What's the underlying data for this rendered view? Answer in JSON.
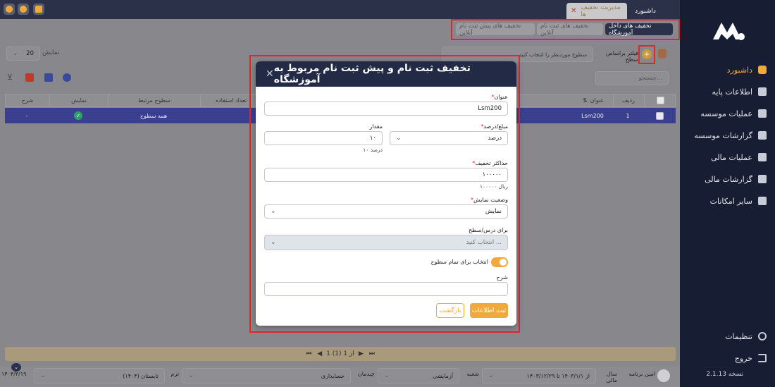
{
  "topbar": {
    "tabs": [
      {
        "label": "داشبورد"
      },
      {
        "label": "مدیریت تخفیف ها"
      }
    ],
    "close_symbol": "✕"
  },
  "sidebar": {
    "items": [
      {
        "label": "داشبورد",
        "icon": "dashboard-icon",
        "active": true
      },
      {
        "label": "اطلاعات پایه",
        "icon": "layers-icon"
      },
      {
        "label": "عملیات موسسه",
        "icon": "database-icon"
      },
      {
        "label": "گزارشات موسسه",
        "icon": "bar-chart-icon"
      },
      {
        "label": "عملیات مالی",
        "icon": "finance-icon"
      },
      {
        "label": "گزارشات مالی",
        "icon": "report-icon"
      },
      {
        "label": "سایر امکانات",
        "icon": "more-icon"
      }
    ],
    "settings_label": "تنظیمات",
    "logout_label": "خروج",
    "version": "نسخه 2.1.13"
  },
  "subtabs": [
    {
      "label": "تخفیف های داخل آموزشگاه",
      "active": true
    },
    {
      "label": "تخفیف های ثبت نام آنلاین"
    },
    {
      "label": "تخفیف های پیش ثبت نام آنلاین"
    }
  ],
  "toolbar": {
    "filter_label": "فیلتر براساس سطح",
    "filter_placeholder": "سطوح موردنظر را انتخاب کنید",
    "show_label": "نمایش",
    "page_size": "20",
    "search_placeholder": "جستجو..."
  },
  "grid": {
    "headers": [
      "ردیف",
      "عنوان",
      "تعداد استفاده",
      "سطوح مرتبط",
      "نمایش",
      "شرح"
    ],
    "row": {
      "index": "1",
      "title": "Lsm200",
      "levels": "همه سطوح",
      "desc": "-"
    }
  },
  "pager": {
    "text": "1 از 1 (1)"
  },
  "bottombar": {
    "user": "امین برنامه",
    "fiscal_year_label": "سال مالی",
    "fiscal_year": "از ۱۴۰۳/۱/۱ تا ۱۴۰۳/۱۲/۲۹",
    "branch_label": "شعبه",
    "branch": "آزمایشی",
    "section_label": "چیدمان",
    "section": "حسابداری",
    "term_label": "ترم",
    "term": "تابستان (۱۴۰۴)",
    "date": "۱۴۰۴/۳/۱۹"
  },
  "modal": {
    "title": "تخفیف ثبت نام و پیش ثبت نام مربوط به آموزشگاه",
    "close_symbol": "✕",
    "title_label": "عنوان",
    "title_value": "Lsm200",
    "type_label": "مبلغ/درصد",
    "type_value": "درصد",
    "amount_label": "مقدار",
    "amount_value": "۱۰",
    "amount_hint": "۱۰ درصد",
    "max_label": "حداکثر تخفیف",
    "max_value": "۱۰۰۰۰۰",
    "max_hint": "۱۰۰۰۰۰ ریال",
    "display_label": "وضعیت نمایش",
    "display_value": "نمایش",
    "course_label": "برای درس/سطح",
    "course_placeholder": "انتخاب کنید ...",
    "toggle_label": "انتخاب برای تمام سطوح",
    "desc_label": "شرح",
    "desc_value": "",
    "submit_label": "ثبت اطلاعات",
    "back_label": "بازگشت"
  },
  "colors": {
    "accent": "#f2a93b",
    "navy": "#232a45",
    "sidebar": "#171d33",
    "highlight": "#e0272a"
  }
}
